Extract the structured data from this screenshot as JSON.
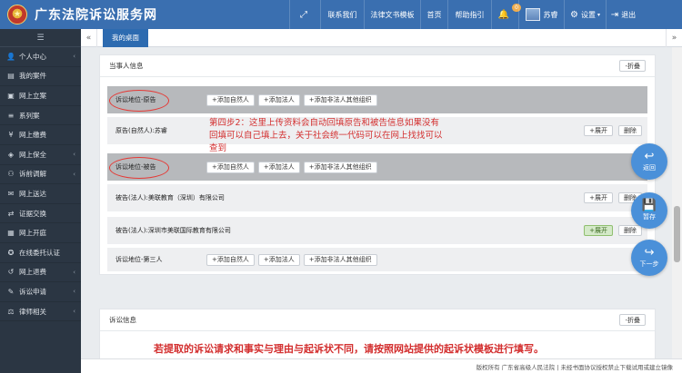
{
  "header": {
    "title": "广东法院诉讼服务网",
    "nav": [
      {
        "label": "",
        "icon": "fullscreen-icon"
      },
      {
        "label": "联系我们"
      },
      {
        "label": "法律文书模板"
      },
      {
        "label": "首页"
      },
      {
        "label": "帮助指引"
      },
      {
        "label": "",
        "icon": "bell-icon",
        "badge": "0"
      },
      {
        "label": "苏睿",
        "icon": "avatar"
      },
      {
        "label": "设置",
        "icon": "gear-icon"
      },
      {
        "label": "退出",
        "icon": "logout-icon"
      }
    ]
  },
  "sidebar": {
    "toggle": "☰",
    "items": [
      {
        "label": "个人中心",
        "icon": "user-icon",
        "expandable": true
      },
      {
        "label": "我的案件",
        "icon": "folder-icon",
        "expandable": false
      },
      {
        "label": "网上立案",
        "icon": "file-icon",
        "expandable": false
      },
      {
        "label": "系列案",
        "icon": "list-icon",
        "expandable": false
      },
      {
        "label": "网上缴费",
        "icon": "payment-icon",
        "expandable": false
      },
      {
        "label": "网上保全",
        "icon": "shield-icon",
        "expandable": true
      },
      {
        "label": "诉前调解",
        "icon": "handshake-icon",
        "expandable": true
      },
      {
        "label": "网上送达",
        "icon": "send-icon",
        "expandable": false
      },
      {
        "label": "证据交换",
        "icon": "exchange-icon",
        "expandable": false
      },
      {
        "label": "网上开庭",
        "icon": "court-icon",
        "expandable": false
      },
      {
        "label": "在线委托认证",
        "icon": "certify-icon",
        "expandable": false
      },
      {
        "label": "网上退费",
        "icon": "refund-icon",
        "expandable": true
      },
      {
        "label": "诉讼申请",
        "icon": "apply-icon",
        "expandable": true
      },
      {
        "label": "律师相关",
        "icon": "lawyer-icon",
        "expandable": true
      }
    ]
  },
  "tabs": {
    "active": "我的桌面"
  },
  "party_panel": {
    "title": "当事人信息",
    "collapse_label": "-折叠",
    "add_person": "+添加自然人",
    "add_legal": "+添加法人",
    "add_other": "+添加非法人其他组织",
    "expand_label": "+展开",
    "delete_label": "删除",
    "rows": [
      {
        "kind": "group",
        "label": "诉讼地位-原告"
      },
      {
        "kind": "party",
        "label": "原告(自然人):苏睿"
      },
      {
        "kind": "group",
        "label": "诉讼地位-被告"
      },
      {
        "kind": "party",
        "label": "被告(法人):美联教育（深圳）有限公司"
      },
      {
        "kind": "party",
        "label": "被告(法人):深圳市美联国际教育有限公司"
      },
      {
        "kind": "group",
        "label": "诉讼地位-第三人"
      }
    ]
  },
  "annotation": {
    "step_note": "第四步2：这里上传资料会自动回填原告和被告信息如果没有回填可以自己填上去，关于社会统一代码可以在网上找找可以查到"
  },
  "claim_panel": {
    "title": "诉讼信息",
    "collapse_label": "-折叠"
  },
  "footer_note": "若提取的诉讼请求和事实与理由与起诉状不同，请按照网站提供的起诉状模板进行填写。",
  "fabs": {
    "back": "返回",
    "save": "暂存",
    "next": "下一步"
  },
  "copyright": "版权所有 广东省高级人民法院 | 未经书面协议授权禁止下载试用或建立镜像",
  "colors": {
    "header": "#3a6fb0",
    "sidebar": "#2b3643",
    "accent": "#4a90d9",
    "annotation": "#d32f2f"
  }
}
